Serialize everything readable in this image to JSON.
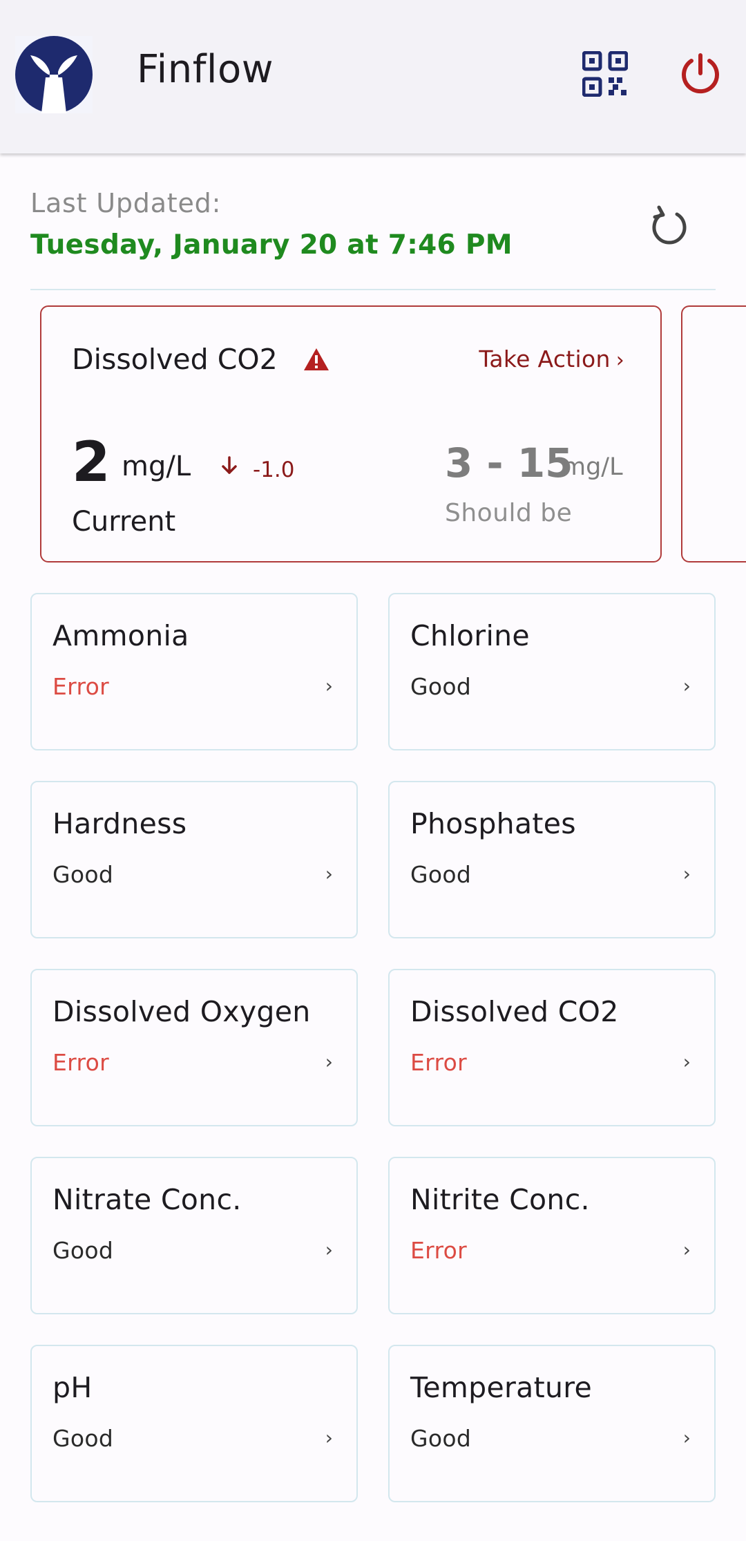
{
  "app": {
    "title": "Finflow"
  },
  "status": {
    "last_updated_label": "Last Updated:",
    "last_updated_value": "Tuesday, January 20 at 7:46 PM"
  },
  "alert": {
    "title": "Dissolved CO2",
    "action_label": "Take Action",
    "action_chevron": "›",
    "current_value": "2",
    "current_unit": "mg/L",
    "trend_value": "-1.0",
    "current_label": "Current",
    "range_value": "3 - 15",
    "range_unit": "mg/L",
    "range_label": "Should be"
  },
  "parameters": [
    {
      "name": "Ammonia",
      "status": "Error"
    },
    {
      "name": "Chlorine",
      "status": "Good"
    },
    {
      "name": "Hardness",
      "status": "Good"
    },
    {
      "name": "Phosphates",
      "status": "Good"
    },
    {
      "name": "Dissolved Oxygen",
      "status": "Error"
    },
    {
      "name": "Dissolved CO2",
      "status": "Error"
    },
    {
      "name": "Nitrate Conc.",
      "status": "Good"
    },
    {
      "name": "Nitrite Conc.",
      "status": "Error"
    },
    {
      "name": "pH",
      "status": "Good"
    },
    {
      "name": "Temperature",
      "status": "Good"
    }
  ],
  "tile_chevron": "›",
  "colors": {
    "accent_red": "#8b1a1a",
    "error_text": "#dc4b43",
    "updated_green": "#1f8a1f",
    "logo_navy": "#1e2a6e"
  },
  "icons": {
    "logo": "whale-tail-logo",
    "qr": "qr-code-scan-icon",
    "power": "power-icon",
    "refresh": "refresh-icon",
    "warning": "warning-triangle-icon",
    "trend": "arrow-down-icon"
  }
}
